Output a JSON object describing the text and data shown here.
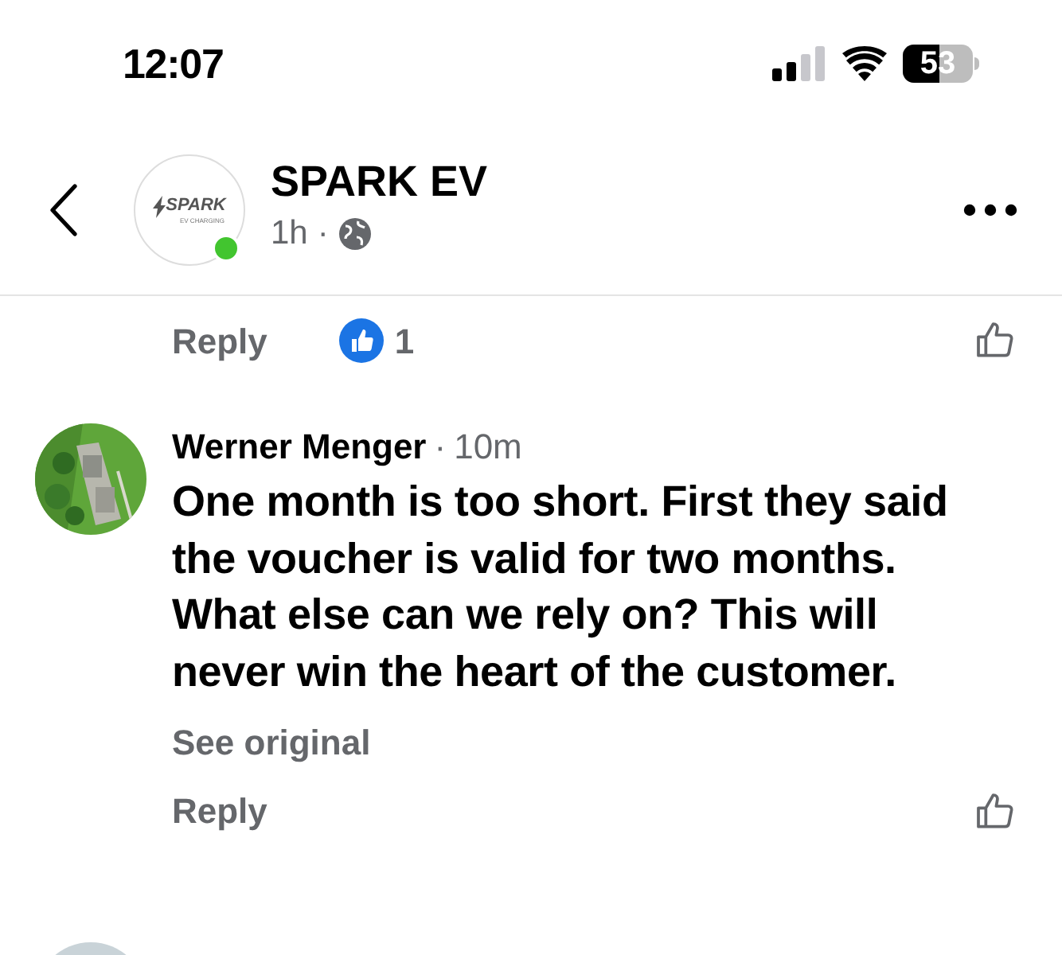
{
  "status_bar": {
    "time": "12:07",
    "battery": "53"
  },
  "header": {
    "page_name": "SPARK EV",
    "logo_text": "SPARK",
    "logo_subtext": "EV CHARGING",
    "online": true,
    "time": "1h",
    "separator": "·"
  },
  "previous_comment": {
    "reply": "Reply",
    "reaction_count": "1"
  },
  "comment": {
    "author": "Werner Menger",
    "separator": "·",
    "time": "10m",
    "text": "One month is too short. First they said the voucher is valid for two months. What else can we rely on? This will never win the heart of the customer.",
    "see_original": "See original",
    "reply": "Reply"
  }
}
